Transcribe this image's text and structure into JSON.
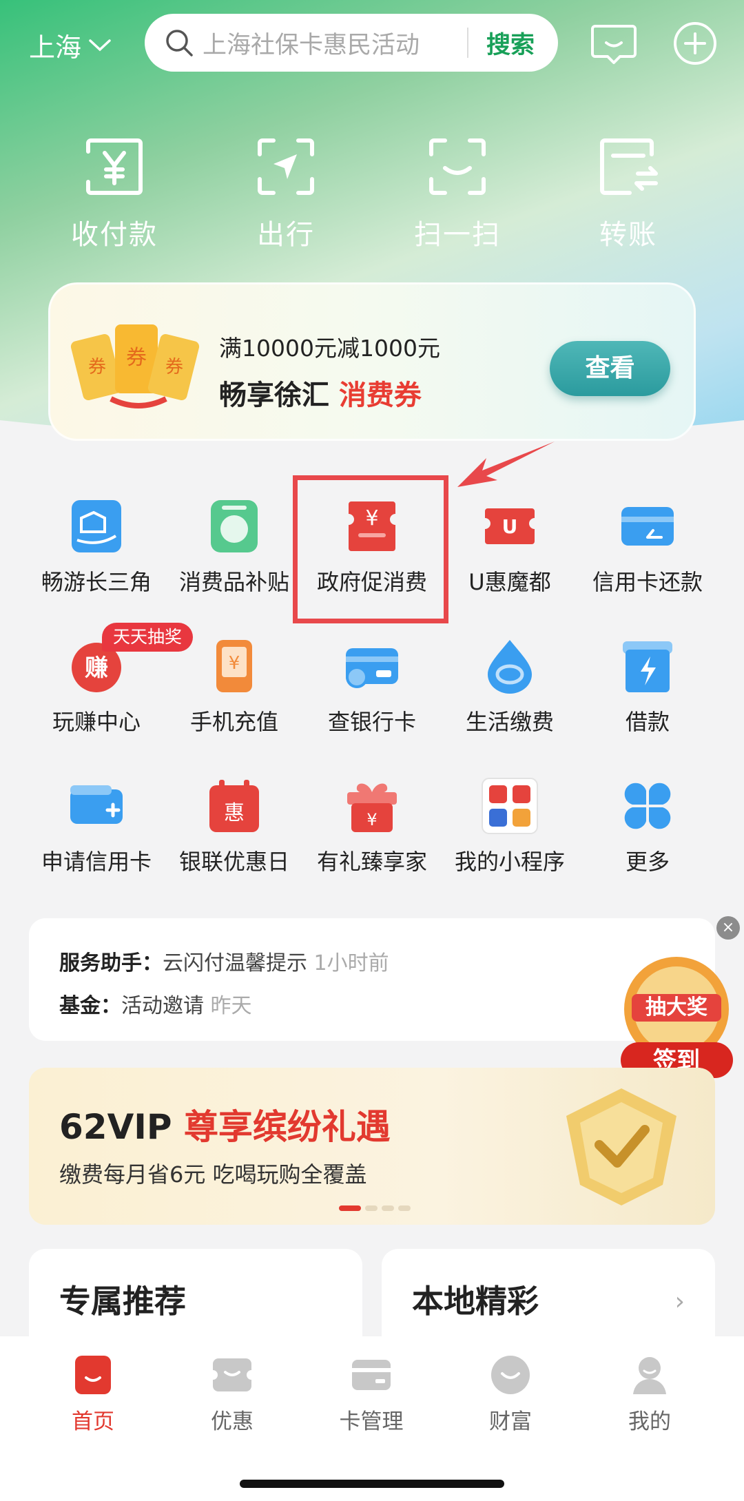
{
  "header": {
    "city": "上海",
    "search_placeholder": "上海社保卡惠民活动",
    "search_button": "搜索"
  },
  "quick_actions": [
    {
      "label": "收付款",
      "icon": "yuan-scan-icon"
    },
    {
      "label": "出行",
      "icon": "navigation-icon"
    },
    {
      "label": "扫一扫",
      "icon": "scan-icon"
    },
    {
      "label": "转账",
      "icon": "transfer-icon"
    }
  ],
  "promo": {
    "line1": "满10000元减1000元",
    "line2_prefix": "畅享徐汇 ",
    "line2_highlight": "消费券",
    "button": "查看",
    "coupon_text": [
      "券",
      "券",
      "券"
    ]
  },
  "services": [
    {
      "label": "畅游长三角",
      "color": "#3a9ef0"
    },
    {
      "label": "消费品补贴",
      "color": "#56c98e"
    },
    {
      "label": "政府促消费",
      "color": "#e5433d"
    },
    {
      "label": "U惠魔都",
      "color": "#e5433d"
    },
    {
      "label": "信用卡还款",
      "color": "#3a9ef0"
    },
    {
      "label": "玩赚中心",
      "color": "#e5433d"
    },
    {
      "label": "手机充值",
      "color": "#f28a3a"
    },
    {
      "label": "查银行卡",
      "color": "#3a9ef0"
    },
    {
      "label": "生活缴费",
      "color": "#3a9ef0"
    },
    {
      "label": "借款",
      "color": "#3a9ef0"
    },
    {
      "label": "申请信用卡",
      "color": "#3a9ef0"
    },
    {
      "label": "银联优惠日",
      "color": "#e5433d"
    },
    {
      "label": "有礼臻享家",
      "color": "#e5433d"
    },
    {
      "label": "我的小程序",
      "color": "#cccccc"
    },
    {
      "label": "更多",
      "color": "#3a9ef0"
    }
  ],
  "service_badge": "天天抽奖",
  "icon_glyphs": {
    "earn": "赚",
    "yuan": "¥",
    "u": "U",
    "hui": "惠"
  },
  "notices": [
    {
      "key": "服务助手：",
      "value": "云闪付温馨提示",
      "time": " 1小时前"
    },
    {
      "key": "基金：",
      "value": "活动邀请",
      "time": " 昨天"
    }
  ],
  "lottery": {
    "top": "抽大奖",
    "bottom": "签到"
  },
  "vip": {
    "title_prefix": "62VIP ",
    "title_highlight": "尊享缤纷礼遇",
    "subtitle": "缴费每月省6元 吃喝玩购全覆盖"
  },
  "cards": [
    {
      "title": "专属推荐"
    },
    {
      "title": "本地精彩",
      "chevron": "›"
    }
  ],
  "tabs": [
    {
      "label": "首页",
      "active": true
    },
    {
      "label": "优惠"
    },
    {
      "label": "卡管理"
    },
    {
      "label": "财富"
    },
    {
      "label": "我的"
    }
  ],
  "colors": {
    "accent_red": "#e2392f",
    "highlight_border": "#e8484b",
    "search_green": "#18a058",
    "tab_inactive": "#c8c8c8"
  }
}
